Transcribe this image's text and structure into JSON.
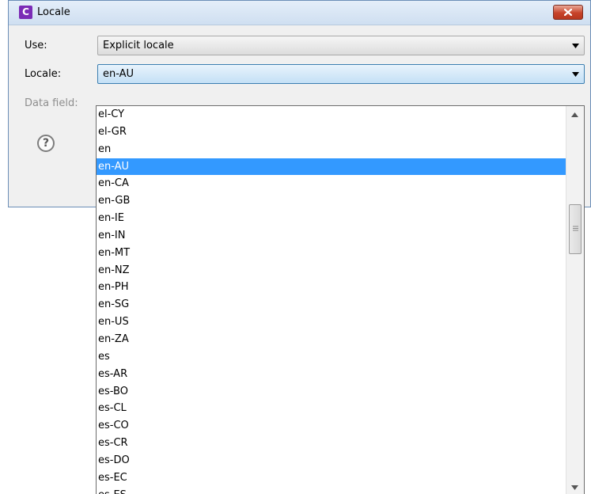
{
  "window": {
    "title": "Locale",
    "app_icon_letter": "C",
    "close_icon": "close-icon"
  },
  "form": {
    "use_label": "Use:",
    "use_value": "Explicit locale",
    "locale_label": "Locale:",
    "locale_value": "en-AU",
    "data_field_label": "Data field:",
    "help_icon_glyph": "?"
  },
  "dropdown": {
    "selected": "en-AU",
    "items": [
      "el-CY",
      "el-GR",
      "en",
      "en-AU",
      "en-CA",
      "en-GB",
      "en-IE",
      "en-IN",
      "en-MT",
      "en-NZ",
      "en-PH",
      "en-SG",
      "en-US",
      "en-ZA",
      "es",
      "es-AR",
      "es-BO",
      "es-CL",
      "es-CO",
      "es-CR",
      "es-DO",
      "es-EC",
      "es-ES"
    ]
  },
  "colors": {
    "selection": "#3399ff",
    "app_icon": "#7b2bb6",
    "close_button": "#c7432a"
  }
}
